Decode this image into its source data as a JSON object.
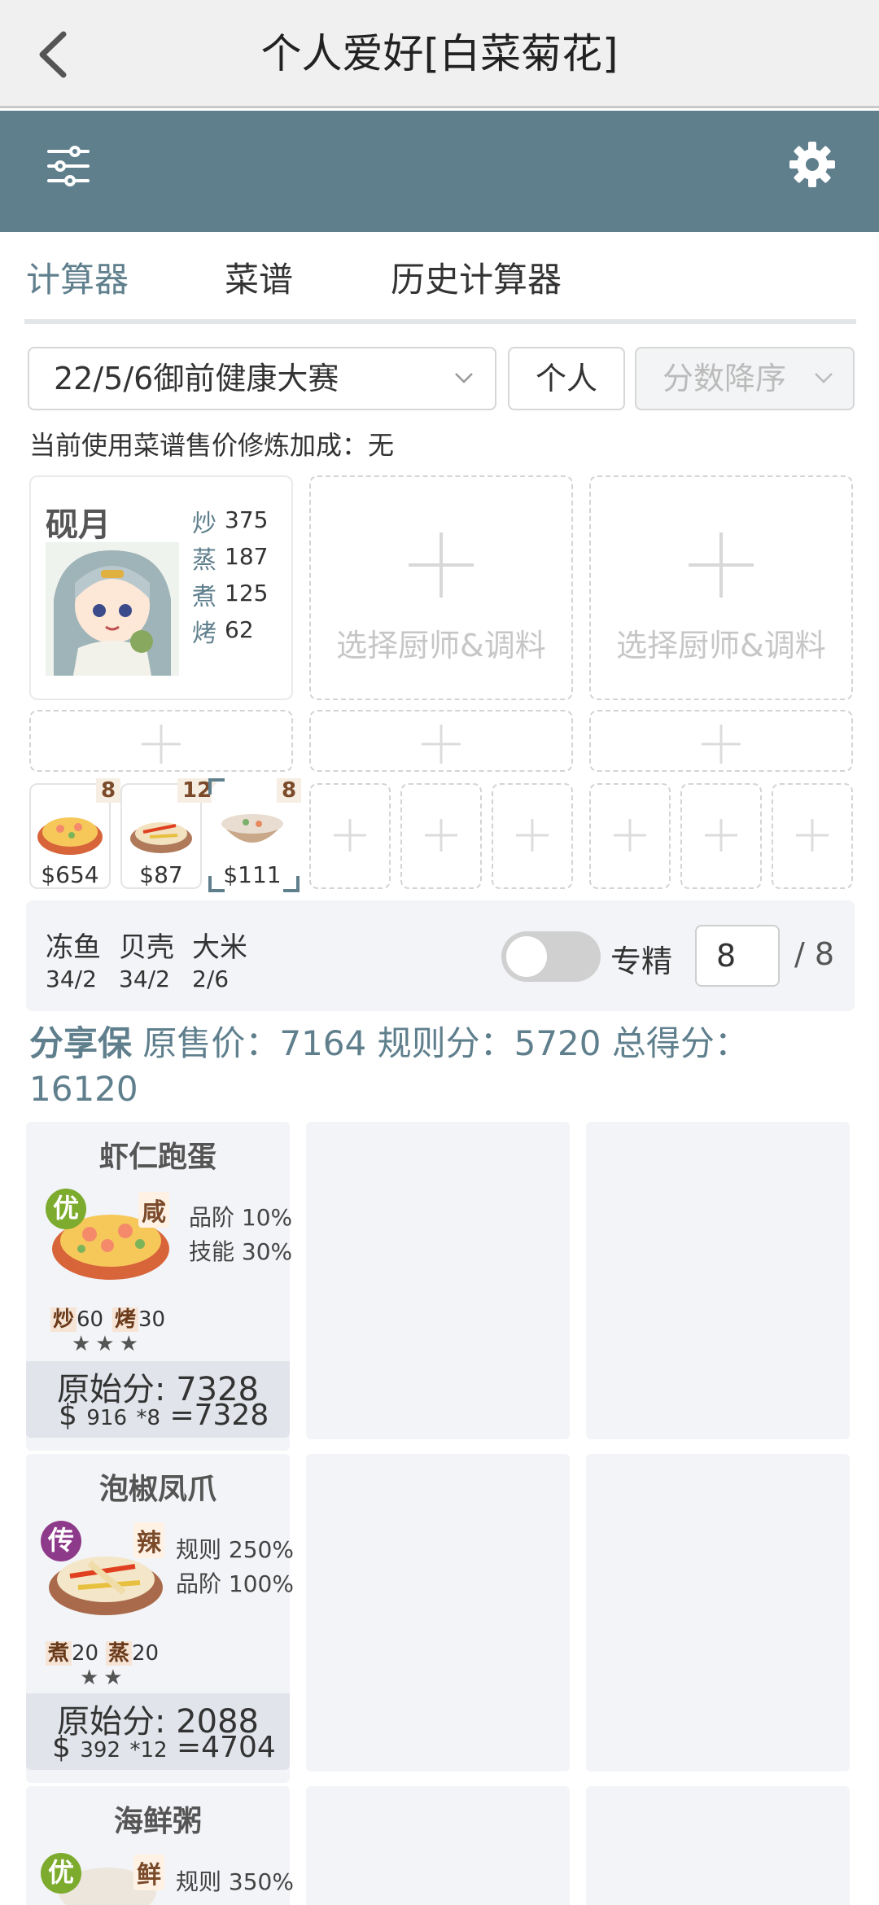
{
  "header": {
    "title": "个人爱好[白菜菊花]"
  },
  "tabs": [
    {
      "label": "计算器",
      "active": true
    },
    {
      "label": "菜谱"
    },
    {
      "label": "历史计算器"
    }
  ],
  "controls": {
    "event": "22/5/6御前健康大赛",
    "mode": "个人",
    "sort": "分数降序"
  },
  "bonus_text": "当前使用菜谱售价修炼加成：无",
  "chef": {
    "name": "砚月",
    "skills": [
      {
        "label": "炒",
        "value": "375"
      },
      {
        "label": "蒸",
        "value": "187"
      },
      {
        "label": "煮",
        "value": "125"
      },
      {
        "label": "烤",
        "value": "62"
      }
    ]
  },
  "empty_chef_label": "选择厨师&调料",
  "dishes": [
    {
      "count": "8",
      "price": "$654"
    },
    {
      "count": "12",
      "price": "$87"
    },
    {
      "count": "8",
      "price": "$111"
    }
  ],
  "ingredients": [
    {
      "name": "冻鱼",
      "qty": "34/2"
    },
    {
      "name": "贝壳",
      "qty": "34/2"
    },
    {
      "name": "大米",
      "qty": "2/6"
    }
  ],
  "specialty": {
    "label": "专精",
    "value": "8",
    "max": "/ 8",
    "on": false
  },
  "score_line": {
    "share": "分享保",
    "text": " 原售价：7164 规则分：5720 总得分：16120"
  },
  "recipes": [
    {
      "name": "虾仁跑蛋",
      "grade": "优",
      "taste": "咸",
      "buffs": [
        "品阶 10%",
        "技能 30%"
      ],
      "cook": [
        {
          "k": "炒",
          "v": "60"
        },
        {
          "k": "烤",
          "v": "30"
        }
      ],
      "stars": "★★★",
      "raw": "原始分: 7328",
      "price": "916",
      "mult": "*8",
      "total": "=7328"
    },
    {
      "name": "泡椒凤爪",
      "grade": "传",
      "taste": "辣",
      "buffs": [
        "规则 250%",
        "品阶 100%"
      ],
      "cook": [
        {
          "k": "煮",
          "v": "20"
        },
        {
          "k": "蒸",
          "v": "20"
        }
      ],
      "stars": "★★",
      "raw": "原始分: 2088",
      "price": "392",
      "mult": "*12",
      "total": "=4704"
    },
    {
      "name": "海鲜粥",
      "grade": "优",
      "taste": "鲜",
      "buffs": [
        "规则 350%"
      ]
    }
  ],
  "colors": {
    "accent": "#5f7f8d",
    "grade_good": "#7cab2e",
    "grade_legend": "#8e3a8a"
  },
  "icons": [
    "back-icon",
    "filter-icon",
    "gear-icon",
    "chevron-down-icon",
    "plus-icon",
    "dollar-icon"
  ]
}
